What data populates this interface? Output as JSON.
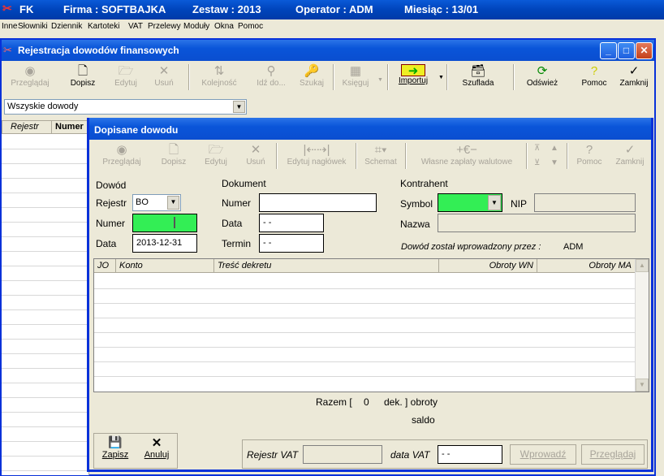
{
  "app_title": {
    "name": "FK",
    "firma": "Firma : SOFTBAJKA",
    "zestaw": "Zestaw : 2013",
    "operator": "Operator : ADM",
    "miesiac": "Miesiąc : 13/01"
  },
  "menu": [
    "Inne",
    "Słowniki",
    "Dziennik",
    "Kartoteki",
    "VAT",
    "Przelewy",
    "Moduły",
    "Okna",
    "Pomoc"
  ],
  "mdi": {
    "title": "Rejestracja dowodów finansowych",
    "toolbar": [
      {
        "label": "Przeglądaj",
        "icon": "eye-icon",
        "enabled": false
      },
      {
        "label": "Dopisz",
        "icon": "new-document-icon",
        "enabled": true
      },
      {
        "label": "Edytuj",
        "icon": "folder-edit-icon",
        "enabled": false
      },
      {
        "label": "Usuń",
        "icon": "delete-x-icon",
        "enabled": false
      },
      {
        "label": "Kolejność",
        "icon": "sort-icon",
        "enabled": false
      },
      {
        "label": "Idź do...",
        "icon": "goto-icon",
        "enabled": false
      },
      {
        "label": "Szukaj",
        "icon": "search-icon",
        "enabled": false
      },
      {
        "label": "Księguj",
        "icon": "book-icon",
        "enabled": false
      },
      {
        "label": "Importuj",
        "icon": "import-icon",
        "enabled": true
      },
      {
        "label": "Szuflada",
        "icon": "drawer-icon",
        "enabled": true
      },
      {
        "label": "Odśwież",
        "icon": "refresh-icon",
        "enabled": true
      },
      {
        "label": "Pomoc",
        "icon": "help-icon",
        "enabled": true
      },
      {
        "label": "Zamknij",
        "icon": "checkmark-icon",
        "enabled": true
      }
    ],
    "filter_value": "Wszyskie dowody",
    "grid_headers": [
      "Rejestr",
      "Numer"
    ]
  },
  "dialog": {
    "title": "Dopisane dowodu",
    "toolbar": [
      {
        "label": "Przeglądaj",
        "icon": "eye-icon"
      },
      {
        "label": "Dopisz",
        "icon": "new-document-icon"
      },
      {
        "label": "Edytuj",
        "icon": "folder-edit-icon"
      },
      {
        "label": "Usuń",
        "icon": "delete-x-icon"
      },
      {
        "label": "Edytuj nagłówek",
        "icon": "header-edit-icon"
      },
      {
        "label": "Schemat",
        "icon": "schema-icon"
      },
      {
        "label": "Własne zapłaty walutowe",
        "icon": "currency-icon"
      },
      {
        "label": "Pomoc",
        "icon": "help-icon"
      },
      {
        "label": "Zamknij",
        "icon": "checkmark-icon"
      }
    ],
    "dowod": {
      "section": "Dowód",
      "rejestr_label": "Rejestr",
      "rejestr_value": "BO",
      "numer_label": "Numer",
      "numer_value": "",
      "data_label": "Data",
      "data_value": "2013-12-31"
    },
    "dokument": {
      "section": "Dokument",
      "numer_label": "Numer",
      "numer_value": "",
      "data_label": "Data",
      "data_value": " - -",
      "termin_label": "Termin",
      "termin_value": " - -"
    },
    "kontrahent": {
      "section": "Kontrahent",
      "symbol_label": "Symbol",
      "symbol_value": "",
      "nip_label": "NIP",
      "nip_value": "",
      "nazwa_label": "Nazwa",
      "nazwa_value": ""
    },
    "entered_by": "Dowód został wprowadzony przez :",
    "entered_by_value": "ADM",
    "table_headers": [
      "JO",
      "Konto",
      "Treść dekretu",
      "Obroty WN",
      "Obroty MA"
    ],
    "razem": "Razem [",
    "razem_count": "0",
    "razem_suffix": "dek. ] obroty",
    "saldo": "saldo",
    "zapisz": "Zapisz",
    "anuluj": "Anuluj",
    "rejestr_vat_label": "Rejestr VAT",
    "rejestr_vat_value": "",
    "data_vat_label": "data VAT",
    "data_vat_value": " - -",
    "wprowadz": "Wprowadź",
    "przegladaj": "Przeglądaj"
  },
  "colors": {
    "titlebar": "#0a55d9",
    "required_field": "#33ee55",
    "window_bg": "#ece9d8"
  }
}
